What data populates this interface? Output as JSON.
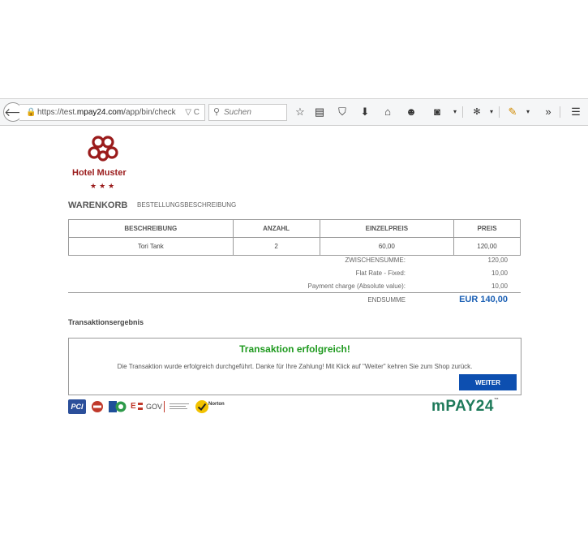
{
  "browser": {
    "url_prefix": "https://test.",
    "url_domain": "mpay24.com",
    "url_path": "/app/bin/check",
    "url_ctrls": "▽ C",
    "search_placeholder": "Suchen"
  },
  "hotel": {
    "name": "Hotel Muster",
    "stars": "★★★"
  },
  "cart": {
    "title": "WARENKORB",
    "subtitle": "BESTELLUNGSBESCHREIBUNG",
    "columns": [
      "BESCHREIBUNG",
      "ANZAHL",
      "EINZELPREIS",
      "PREIS"
    ],
    "rows": [
      [
        "Tori Tank",
        "2",
        "60,00",
        "120,00"
      ]
    ],
    "totals": [
      {
        "label": "ZWISCHENSUMME:",
        "value": "120,00"
      },
      {
        "label": "Flat Rate - Fixed:",
        "value": "10,00"
      },
      {
        "label": "Payment charge (Absolute value):",
        "value": "10,00"
      }
    ],
    "end_label": "ENDSUMME",
    "end_value": "EUR 140,00"
  },
  "transaction": {
    "section_title": "Transaktionsergebnis",
    "status": "Transaktion erfolgreich!",
    "message": "Die Transaktion wurde erfolgreich durchgeführt. Danke für Ihre Zahlung! Mit Klick auf \"Weiter\" kehren Sie zum Shop zurück.",
    "button": "WEITER"
  },
  "footer": {
    "pci": "PCI",
    "egov_e": "E",
    "egov": "GOV",
    "norton": "Norton",
    "brand": "mPAY24",
    "brand_tm": "™"
  },
  "colors": {
    "hotel": "#9a1b1b",
    "success": "#1f9a1f",
    "button": "#0d4fb0",
    "total": "#1a5fb4",
    "brand": "#1e7a5a"
  }
}
